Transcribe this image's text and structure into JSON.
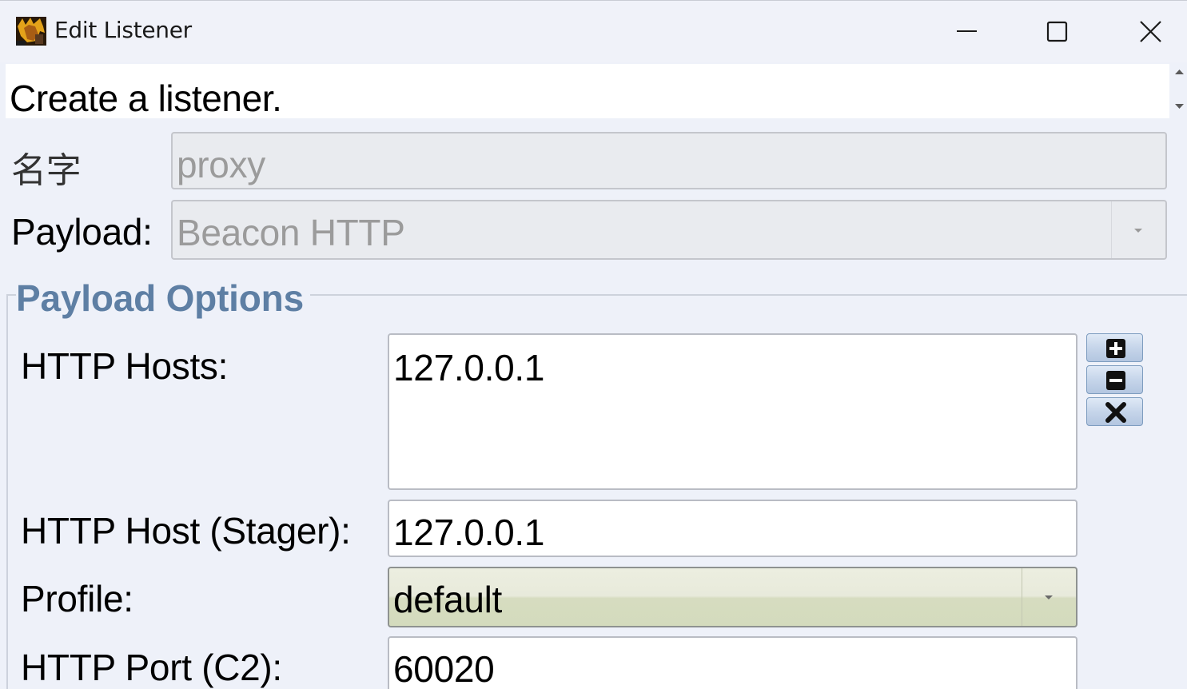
{
  "window": {
    "title": "Edit Listener",
    "icons": {
      "app": "app-icon",
      "minimize": "minimize-icon",
      "maximize": "maximize-icon",
      "close": "close-icon"
    }
  },
  "banner": {
    "text": "Create a listener."
  },
  "form": {
    "name_label": "名字",
    "name_value": "proxy",
    "payload_label": "Payload:",
    "payload_value": "Beacon HTTP"
  },
  "payload_options": {
    "legend": "Payload Options",
    "http_hosts_label": "HTTP Hosts:",
    "http_hosts": [
      "127.0.0.1"
    ],
    "host_buttons": [
      "add-icon",
      "remove-icon",
      "clear-icon"
    ],
    "stager_label": "HTTP Host (Stager):",
    "stager_value": "127.0.0.1",
    "profile_label": "Profile:",
    "profile_value": "default",
    "port_label": "HTTP Port (C2):",
    "port_value": "60020"
  },
  "colors": {
    "background": "#eef1f9",
    "legend": "#5e7fa4",
    "profile_combo": "#d6dcc0",
    "side_button": "#c6d5ea"
  }
}
